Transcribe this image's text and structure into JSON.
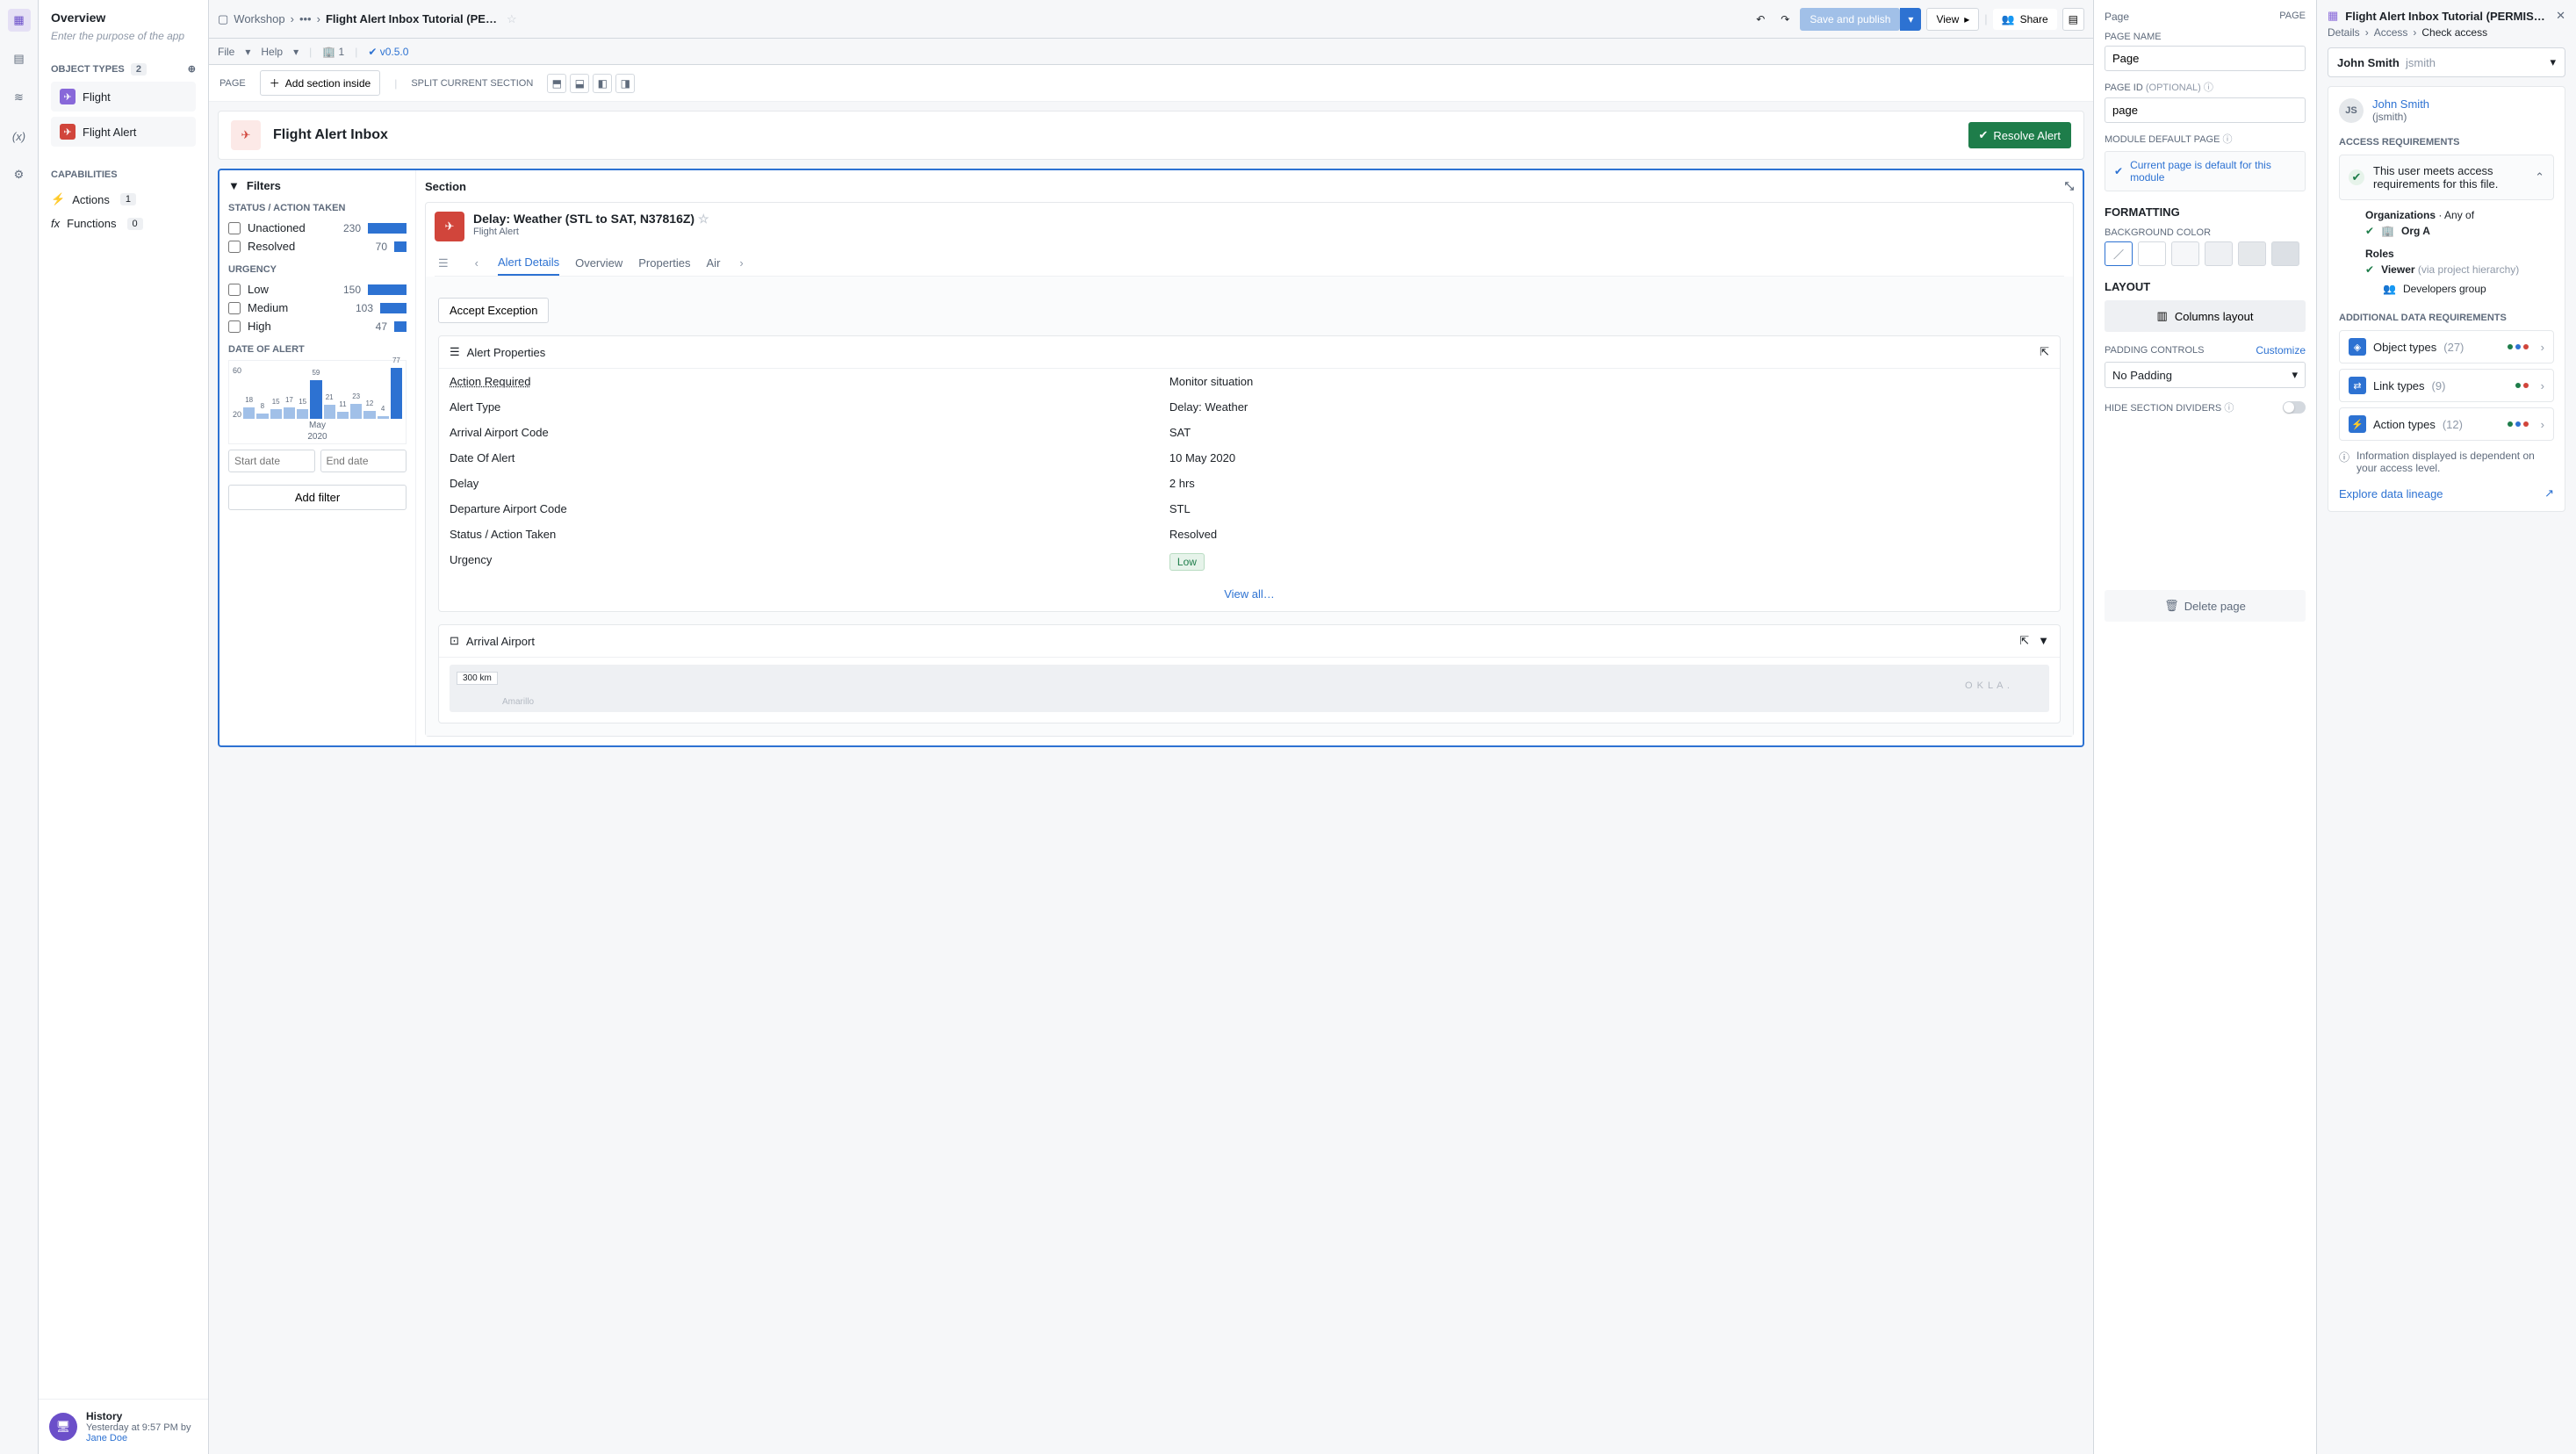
{
  "topbar": {
    "workshop": "Workshop",
    "title": "Flight Alert Inbox Tutorial (PERMI...",
    "file_menu": "File",
    "help_menu": "Help",
    "user_count": "1",
    "version": "v0.5.0",
    "save_publish": "Save and publish",
    "view": "View",
    "share": "Share"
  },
  "left": {
    "overview": "Overview",
    "purpose_placeholder": "Enter the purpose of the app",
    "object_types_label": "OBJECT TYPES",
    "object_types_count": "2",
    "flight": "Flight",
    "flight_alert": "Flight Alert",
    "capabilities_label": "CAPABILITIES",
    "actions": "Actions",
    "actions_count": "1",
    "functions": "Functions",
    "functions_count": "0",
    "history_title": "History",
    "history_time": "Yesterday at 9:57 PM by",
    "history_user": "Jane Doe"
  },
  "toolbar": {
    "page_label": "PAGE",
    "add_section": "Add section inside",
    "split_label": "SPLIT CURRENT SECTION"
  },
  "page_header": {
    "title": "Flight Alert Inbox",
    "resolve": "Resolve Alert"
  },
  "filters": {
    "title": "Filters",
    "g1_label": "STATUS / ACTION TAKEN",
    "g1": [
      {
        "label": "Unactioned",
        "count": "230",
        "bar": 44
      },
      {
        "label": "Resolved",
        "count": "70",
        "bar": 14
      }
    ],
    "g2_label": "URGENCY",
    "g2": [
      {
        "label": "Low",
        "count": "150",
        "bar": 44
      },
      {
        "label": "Medium",
        "count": "103",
        "bar": 30
      },
      {
        "label": "High",
        "count": "47",
        "bar": 14
      }
    ],
    "date_label": "DATE OF ALERT",
    "start_ph": "Start date",
    "end_ph": "End date",
    "add_filter": "Add filter",
    "histo_month": "May",
    "histo_year": "2020"
  },
  "section": {
    "title": "Section",
    "alert_title": "Delay: Weather (STL to SAT, N37816Z)",
    "alert_sub": "Flight Alert",
    "tabs": [
      "Alert Details",
      "Overview",
      "Properties",
      "Air"
    ],
    "accept": "Accept Exception",
    "props_title": "Alert Properties",
    "rows": [
      {
        "k": "Action Required",
        "v": "Monitor situation",
        "u": true
      },
      {
        "k": "Alert Type",
        "v": "Delay: Weather"
      },
      {
        "k": "Arrival Airport Code",
        "v": "SAT"
      },
      {
        "k": "Date Of Alert",
        "v": "10 May 2020"
      },
      {
        "k": "Delay",
        "v": "2 hrs"
      },
      {
        "k": "Departure Airport Code",
        "v": "STL"
      },
      {
        "k": "Status / Action Taken",
        "v": "Resolved"
      },
      {
        "k": "Urgency",
        "v": "Low",
        "badge": true
      }
    ],
    "view_all": "View all…",
    "arrival": "Arrival Airport",
    "map_scale": "300 km",
    "map_text": "O K L A ."
  },
  "config": {
    "head_left": "Page",
    "head_right": "PAGE",
    "name_label": "PAGE NAME",
    "name_value": "Page",
    "id_label": "PAGE ID",
    "id_opt": "(OPTIONAL)",
    "id_value": "page",
    "default_label": "MODULE DEFAULT PAGE",
    "default_notice": "Current page is default for this module",
    "formatting": "FORMATTING",
    "bg_label": "BACKGROUND COLOR",
    "layout": "LAYOUT",
    "columns": "Columns layout",
    "padding_label": "PADDING CONTROLS",
    "customize": "Customize",
    "no_padding": "No Padding",
    "hide_dividers": "HIDE SECTION DIVIDERS",
    "delete": "Delete page"
  },
  "access": {
    "title": "Flight Alert Inbox Tutorial (PERMISSIONS EX...",
    "crumb1": "Details",
    "crumb2": "Access",
    "crumb3": "Check access",
    "user_display": "John Smith",
    "user_login": "jsmith",
    "user_paren": "(jsmith)",
    "avatar": "JS",
    "req_label": "ACCESS REQUIREMENTS",
    "pass_msg": "This user meets access requirements for this file.",
    "orgs_label": "Organizations",
    "any_of": "Any of",
    "org_a": "Org A",
    "roles_label": "Roles",
    "viewer": "Viewer",
    "viewer_via": "(via project hierarchy)",
    "dev_group": "Developers group",
    "add_label": "ADDITIONAL DATA REQUIREMENTS",
    "obj_types": "Object types",
    "obj_count": "(27)",
    "link_types": "Link types",
    "link_count": "(9)",
    "action_types": "Action types",
    "action_count": "(12)",
    "info": "Information displayed is dependent on your access level.",
    "explore": "Explore data lineage"
  },
  "chart_data": {
    "type": "bar",
    "categories": [
      "18",
      "8",
      "15",
      "17",
      "15",
      "59",
      "21",
      "11",
      "23",
      "12",
      "4",
      "77"
    ],
    "values": [
      18,
      8,
      15,
      17,
      15,
      59,
      21,
      11,
      23,
      12,
      4,
      77
    ],
    "ylim": [
      0,
      80
    ],
    "yticks": [
      20,
      60
    ],
    "xlabel": "May 2020"
  }
}
